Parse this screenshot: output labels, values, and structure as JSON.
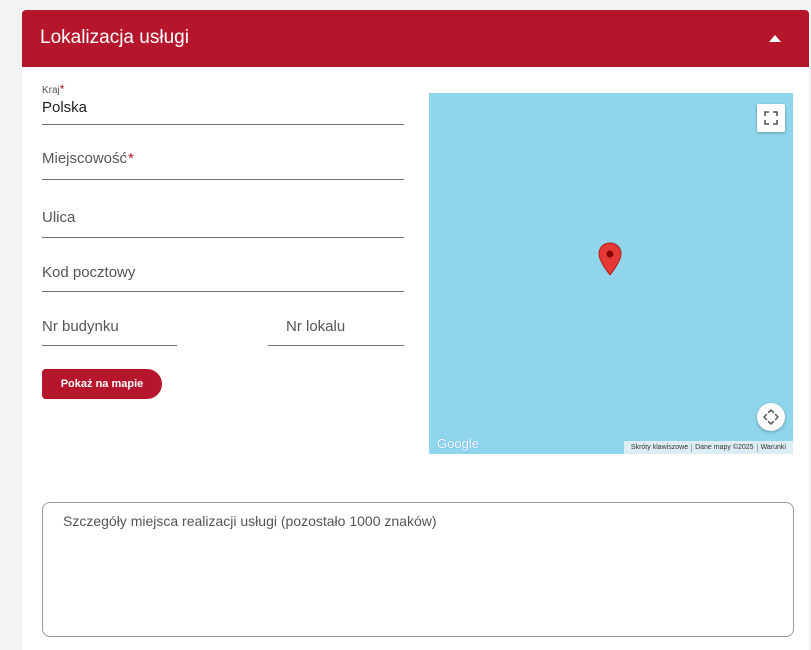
{
  "header": {
    "title": "Lokalizacja usługi"
  },
  "form": {
    "country": {
      "label": "Kraj",
      "required_mark": "*",
      "value": "Polska"
    },
    "city": {
      "label": "Miejscowość",
      "required_mark": "*"
    },
    "street": {
      "label": "Ulica"
    },
    "postal_code": {
      "label": "Kod pocztowy"
    },
    "building_no": {
      "label": "Nr budynku"
    },
    "unit_no": {
      "label": "Nr lokalu"
    },
    "show_on_map_label": "Pokaż na mapie"
  },
  "map": {
    "logo": "Google",
    "footer": [
      "Skróty klawiszowe",
      "Dane mapy ©2025",
      "Warunki"
    ],
    "icons": [
      "fullscreen-icon",
      "map-pin-icon",
      "move-arrows-icon"
    ]
  },
  "details": {
    "placeholder": "Szczegóły miejsca realizacji usługi (pozostało 1000 znaków)"
  },
  "colors": {
    "accent": "#b5162b",
    "map_water": "#8fd6ec"
  }
}
